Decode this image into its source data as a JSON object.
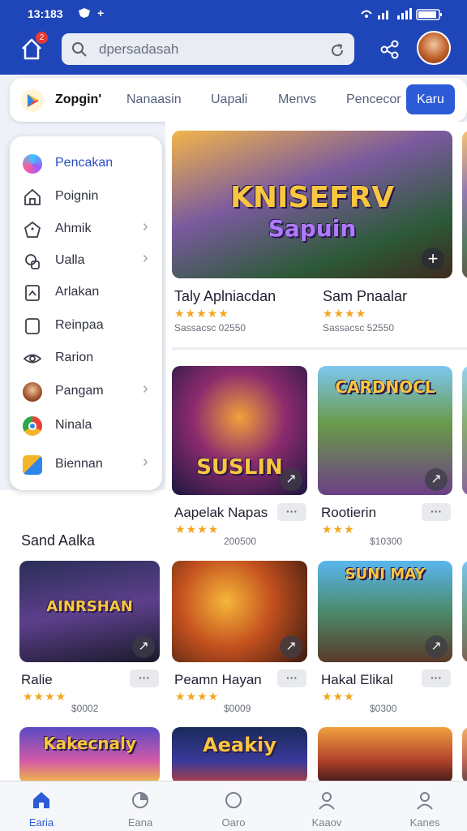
{
  "status_bar": {
    "time": "13:183",
    "extra": "+"
  },
  "header": {
    "notification_count": "2",
    "search_placeholder": "dpersadasah"
  },
  "tabs": [
    {
      "label": "Zopgin'"
    },
    {
      "label": "Nanaasin"
    },
    {
      "label": "Uapali"
    },
    {
      "label": "Menvs"
    },
    {
      "label": "Pencecor"
    },
    {
      "label": "Karu"
    }
  ],
  "sidebar": {
    "items": [
      {
        "label": "Pencakan",
        "icon": "app-gradient-icon"
      },
      {
        "label": "Poignin",
        "icon": "home-icon"
      },
      {
        "label": "Ahmik",
        "icon": "tag-icon"
      },
      {
        "label": "Ualla",
        "icon": "gamepad-icon"
      },
      {
        "label": "Arlakan",
        "icon": "document-icon"
      },
      {
        "label": "Reinpaa",
        "icon": "square-icon"
      },
      {
        "label": "Rarion",
        "icon": "eye-icon"
      },
      {
        "label": "Pangam",
        "icon": "avatar-icon"
      },
      {
        "label": "Ninala",
        "icon": "chrome-icon"
      },
      {
        "label": "Biennan",
        "icon": "folder-icon"
      }
    ]
  },
  "featured": [
    {
      "title_art": "KNISEFRV",
      "title_art_sub": "Sapuin",
      "name": "Taly Aplniacdan",
      "rating": "★★★★★",
      "meta": "Sassacsc 02550"
    },
    {
      "name": "Sam Pnaalar",
      "rating": "★★★★",
      "meta": "Sassacsc 52550"
    }
  ],
  "row2": [
    {
      "title_art": "SUSLIN",
      "name": "Aapelak Napas",
      "rating": "★★★★",
      "meta": "200500"
    },
    {
      "title_art": "CARDNOCL",
      "name": "Rootierin",
      "rating": "★★★",
      "meta": "$10300"
    }
  ],
  "section_title": "Sand Aalka",
  "row3": [
    {
      "title_art": "AINRSHAN",
      "name": "Ralie",
      "rating": "★★★★",
      "meta": "$0002"
    },
    {
      "name": "Peamn Hayan",
      "rating": "★★★★",
      "meta": "$0009"
    },
    {
      "title_art": "SUNI MAY",
      "name": "Hakal Elikal",
      "rating": "★★★",
      "meta": "$0300"
    }
  ],
  "row4": [
    {
      "title_art": "Kakecnaly"
    },
    {
      "title_art": "Aeakiy"
    },
    {
      "title_art": ""
    }
  ],
  "bottom_nav": [
    {
      "label": "Earia",
      "icon": "home-icon",
      "active": true
    },
    {
      "label": "Eana",
      "icon": "pie-icon"
    },
    {
      "label": "Oaro",
      "icon": "circle-icon"
    },
    {
      "label": "Kaaov",
      "icon": "user-icon"
    },
    {
      "label": "Kanes",
      "icon": "person-icon"
    }
  ],
  "colors": {
    "primary": "#1f46b8",
    "accent": "#2d5ad6",
    "star": "#f2a520"
  }
}
